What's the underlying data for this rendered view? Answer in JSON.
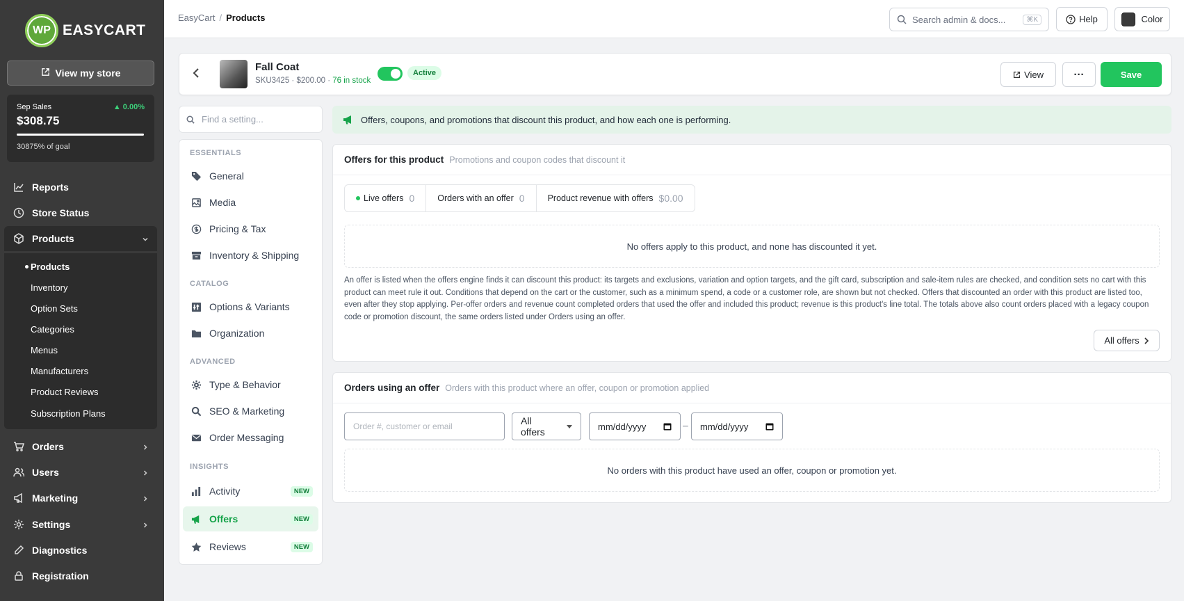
{
  "sidebar": {
    "logo_mark": "WP",
    "logo_text": "EASYCART",
    "view_store": "View my store",
    "sales": {
      "label": "Sep Sales",
      "change": "▲ 0.00%",
      "amount": "$308.75",
      "goal": "30875% of goal"
    },
    "nav": [
      {
        "label": "Reports"
      },
      {
        "label": "Store Status"
      },
      {
        "label": "Products"
      },
      {
        "label": "Orders"
      },
      {
        "label": "Users"
      },
      {
        "label": "Marketing"
      },
      {
        "label": "Settings"
      },
      {
        "label": "Diagnostics"
      },
      {
        "label": "Registration"
      }
    ],
    "products_sub": [
      "Products",
      "Inventory",
      "Option Sets",
      "Categories",
      "Menus",
      "Manufacturers",
      "Product Reviews",
      "Subscription Plans"
    ]
  },
  "topbar": {
    "breadcrumb_root": "EasyCart",
    "breadcrumb_sep": "/",
    "breadcrumb_current": "Products",
    "search_placeholder": "Search admin & docs...",
    "search_kbd": "⌘K",
    "help": "Help",
    "color": "Color",
    "color_swatch": "#3a3a3a"
  },
  "product": {
    "name": "Fall Coat",
    "meta": "SKU3425 · $200.00 · ",
    "stock": "76 in stock",
    "status": "Active",
    "view": "View",
    "more": "···",
    "save": "Save"
  },
  "settings_nav": {
    "find_placeholder": "Find a setting...",
    "groups": [
      "ESSENTIALS",
      "CATALOG",
      "ADVANCED",
      "INSIGHTS"
    ],
    "items": [
      "General",
      "Media",
      "Pricing & Tax",
      "Inventory & Shipping",
      "Options & Variants",
      "Organization",
      "Type & Behavior",
      "SEO & Marketing",
      "Order Messaging",
      "Activity",
      "Offers",
      "Reviews"
    ],
    "new_badge": "NEW"
  },
  "info_bar": "Offers, coupons, and promotions that discount this product, and how each one is performing.",
  "offers_section": {
    "title": "Offers for this product",
    "subtitle": "Promotions and coupon codes that discount it",
    "stats": [
      {
        "label": "Live offers",
        "value": "0"
      },
      {
        "label": "Orders with an offer",
        "value": "0"
      },
      {
        "label": "Product revenue with offers",
        "value": "$0.00"
      }
    ],
    "empty": "No offers apply to this product, and none has discounted it yet.",
    "description": "An offer is listed when the offers engine finds it can discount this product: its targets and exclusions, variation and option targets, and the gift card, subscription and sale-item rules are checked, and condition sets no cart with this product can meet rule it out. Conditions that depend on the cart or the customer, such as a minimum spend, a code or a customer role, are shown but not checked. Offers that discounted an order with this product are listed too, even after they stop applying. Per-offer orders and revenue count completed orders that used the offer and included this product; revenue is this product's line total. The totals above also count orders placed with a legacy coupon code or promotion discount, the same orders listed under Orders using an offer.",
    "all_offers": "All offers"
  },
  "orders_section": {
    "title": "Orders using an offer",
    "subtitle": "Orders with this product where an offer, coupon or promotion applied",
    "search_placeholder": "Order #, customer or email",
    "filter_value": "All offers",
    "date_from": "mm/dd/yyyy",
    "date_sep": "–",
    "date_to": "mm/dd/yyyy",
    "empty": "No orders with this product have used an offer, coupon or promotion yet."
  },
  "colors": {
    "accent": "#22c55e",
    "sidebar": "#3a3a3a",
    "info_bg": "#e4f3e9"
  }
}
